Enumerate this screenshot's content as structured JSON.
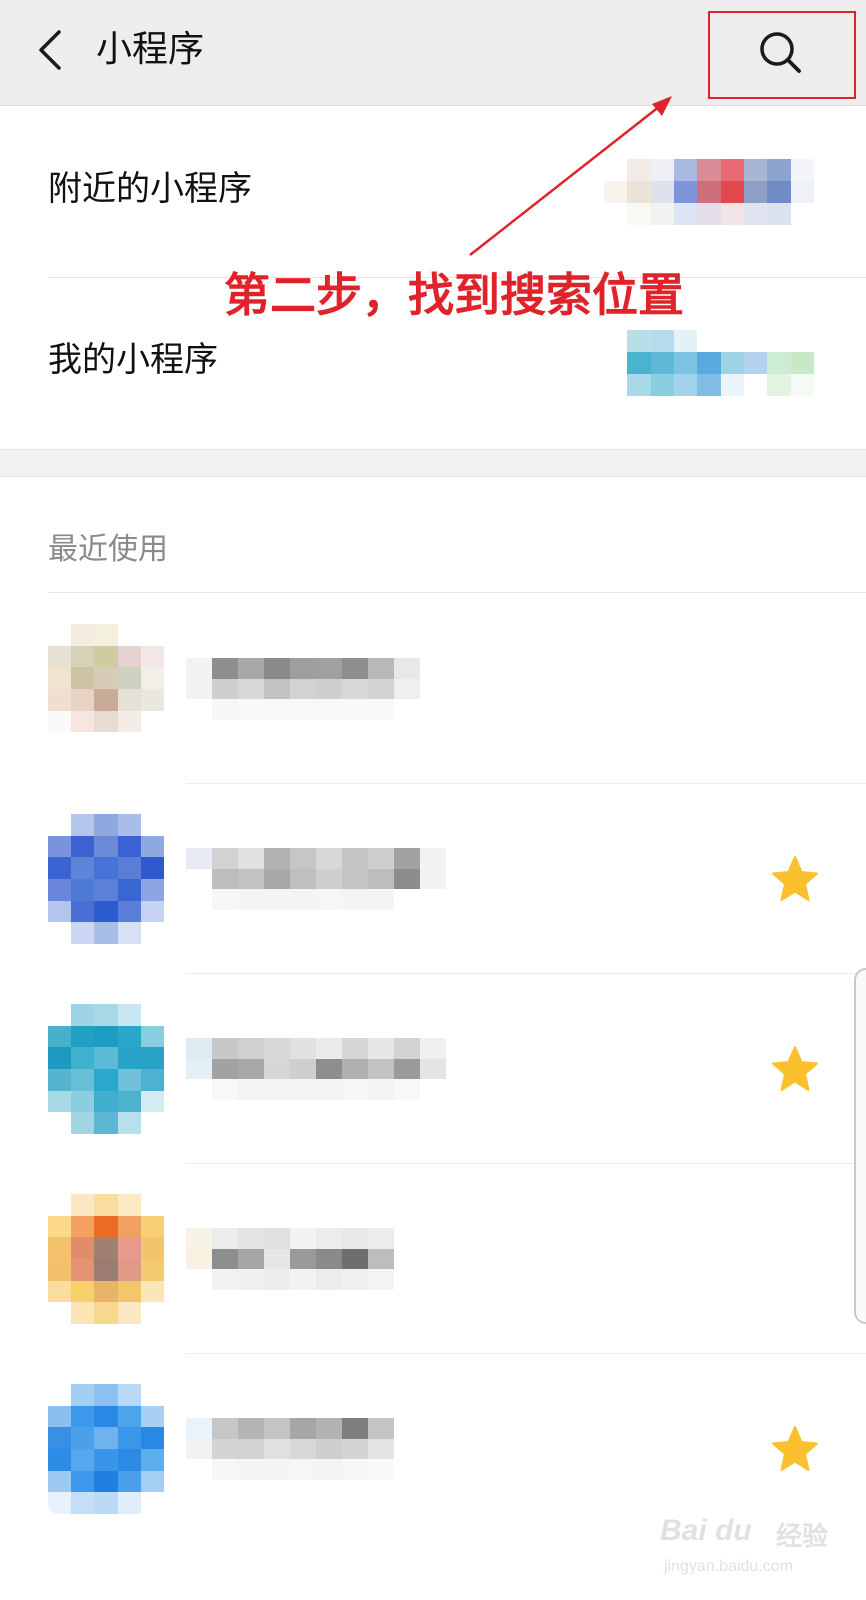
{
  "header": {
    "back_icon": "chevron-left-icon",
    "title": "小程序",
    "search_icon": "search-icon"
  },
  "entries": [
    {
      "label": "附近的小程序",
      "preview_colors": [
        "#ffffff",
        "#f1ede6",
        "#eef0f5",
        "#a9b9e2",
        "#d98c98",
        "#e86a72",
        "#a8b6d4",
        "#8ca5d0",
        "#f4f5f8",
        "#f7f3ea",
        "#ebe4d6",
        "#dfe2ea",
        "#7e96d8",
        "#cf6f7c",
        "#e0474f",
        "#8f9fc4",
        "#6f8cc4",
        "#eef1f6",
        "#ffffff",
        "#faf8f3",
        "#f3f2f2",
        "#dde4f4",
        "#e6ddea",
        "#f2e5e7",
        "#dfe4ef",
        "#dbe3f1",
        "#ffffff"
      ]
    },
    {
      "label": "我的小程序",
      "preview_colors": [
        "#ffffff",
        "#b8dfe8",
        "#b5dcea",
        "#e4f2f8",
        "#ffffff",
        "#ffffff",
        "#ffffff",
        "#ffffff",
        "#ffffff",
        "#ffffff",
        "#4ab3cf",
        "#5fb8d8",
        "#7cc3e2",
        "#5aa9df",
        "#9ed3e5",
        "#b4d2ee",
        "#cdecd4",
        "#c8e8c8",
        "#ffffff",
        "#a8d9e8",
        "#88cde2",
        "#a3d2ec",
        "#7fbde4",
        "#eaf4fa",
        "#ffffff",
        "#e2f3e2",
        "#f4fbf4"
      ]
    }
  ],
  "annotation": {
    "text": "第二步，找到搜索位置",
    "color": "#e0232a"
  },
  "recent": {
    "header": "最近使用",
    "items": [
      {
        "icon_colors": [
          "#ffffff",
          "#f2ede0",
          "#f3f0e0",
          "#ffffff",
          "#ffffff",
          "#e6e1d0",
          "#d6d2b8",
          "#cfcca2",
          "#e6d2d0",
          "#f2e6e6",
          "#f0e4cf",
          "#ccc5a2",
          "#d7ccb6",
          "#cfd2be",
          "#f2eee8",
          "#f2ded0",
          "#e8d2c4",
          "#c8ac98",
          "#e6e0d6",
          "#ece6e0",
          "#fbfaf8",
          "#f7e6e0",
          "#e8dcd2",
          "#f4ece6",
          "#ffffff",
          "#ffffff",
          "#ffffff",
          "#ffffff",
          "#ffffff",
          "#ffffff"
        ],
        "name_colors": [
          "#f2f2f2",
          "#8e8e8e",
          "#a8a8a8",
          "#8a8a8a",
          "#9e9e9e",
          "#a0a0a0",
          "#8e8e8e",
          "#b8b8b8",
          "#e8e8e8",
          "#ffffff",
          "#f2f2f2",
          "#cfcfcf",
          "#d8d8d8",
          "#c2c2c2",
          "#d2d2d2",
          "#cfcfcf",
          "#d8d8d8",
          "#d4d4d4",
          "#f0f0f0",
          "#ffffff",
          "#ffffff",
          "#f6f6f6",
          "#f8f8f8",
          "#f8f8f8",
          "#f8f8f8",
          "#f8f8f8",
          "#f8f8f8",
          "#f8f8f8",
          "#ffffff",
          "#ffffff"
        ],
        "starred": false
      },
      {
        "icon_colors": [
          "#ffffff",
          "#b4c6ec",
          "#8ea8e0",
          "#a8bde8",
          "#ffffff",
          "#7892dc",
          "#3b62d0",
          "#6a8ad8",
          "#3a62d2",
          "#8ea8e0",
          "#3a64d2",
          "#5e86d8",
          "#4674d6",
          "#5a7ed8",
          "#2e58cc",
          "#6a86dc",
          "#4e7ad6",
          "#5a80d8",
          "#3a66d2",
          "#8aa4e4",
          "#b4c4ec",
          "#4a6ed4",
          "#2c5cd0",
          "#5a7ed8",
          "#c6d2f2",
          "#ffffff",
          "#ccd6f2",
          "#a8bcea",
          "#d8e0f4",
          "#ffffff"
        ],
        "name_colors": [
          "#e8ebf6",
          "#d2d2d2",
          "#e2e2e2",
          "#b2b2b2",
          "#c6c6c6",
          "#d8d8d8",
          "#c4c4c4",
          "#cecece",
          "#a2a2a2",
          "#f2f2f2",
          "#ffffff",
          "#bdbdbd",
          "#c2c2c2",
          "#a8a8a8",
          "#bfbfbf",
          "#cfcfcf",
          "#c4c4c4",
          "#bdbdbd",
          "#8c8c8c",
          "#f2f2f2",
          "#ffffff",
          "#f6f6f6",
          "#f4f4f4",
          "#f4f4f4",
          "#f4f4f4",
          "#f6f6f6",
          "#f4f4f4",
          "#f4f4f4",
          "#ffffff",
          "#ffffff"
        ],
        "starred": true
      },
      {
        "icon_colors": [
          "#ffffff",
          "#9dd3e4",
          "#a8d8e8",
          "#c8e6ef",
          "#ffffff",
          "#49b0cc",
          "#21a0c4",
          "#1f9cc2",
          "#2aa6c8",
          "#8acce0",
          "#1e9ac0",
          "#3fb0cf",
          "#5cbad6",
          "#29a4c8",
          "#2aa2c6",
          "#56b4d0",
          "#68c0d8",
          "#2aa8cc",
          "#70c0da",
          "#4cb2d0",
          "#a6d8e6",
          "#8ccddf",
          "#42aecf",
          "#4cb2d0",
          "#d2ecf2",
          "#ffffff",
          "#a0d6e4",
          "#5cb8d2",
          "#b8e0ea",
          "#ffffff"
        ],
        "name_colors": [
          "#dcecf2",
          "#c8c8c8",
          "#d0d0d0",
          "#d8d8d8",
          "#e2e2e2",
          "#ebebeb",
          "#d6d6d6",
          "#e6e6e6",
          "#d2d2d2",
          "#f0f0f0",
          "#e2eff4",
          "#a2a2a2",
          "#a8a8a8",
          "#d6d6d6",
          "#cfcfcf",
          "#8e8e8e",
          "#b0b0b0",
          "#c2c2c2",
          "#9a9a9a",
          "#e4e4e4",
          "#ffffff",
          "#f8f8f8",
          "#f4f4f4",
          "#f4f4f4",
          "#f4f4f4",
          "#f4f4f4",
          "#f6f6f6",
          "#f4f4f4",
          "#f8f8f8",
          "#ffffff"
        ],
        "starred": true
      },
      {
        "icon_colors": [
          "#ffffff",
          "#fbe7c2",
          "#f8dca0",
          "#fbe9c4",
          "#ffffff",
          "#fbd88a",
          "#f4a060",
          "#ec6c24",
          "#f0a060",
          "#f7cf74",
          "#f2c26c",
          "#e28c6c",
          "#a08070",
          "#e8988c",
          "#f2c46c",
          "#f2c06c",
          "#e49474",
          "#9c7c70",
          "#e09a84",
          "#f4ca70",
          "#fadc9c",
          "#f6d06a",
          "#e8b46a",
          "#f4c66c",
          "#fbe6b8",
          "#ffffff",
          "#fbe5b4",
          "#f8d88e",
          "#fbe8c0",
          "#ffffff"
        ],
        "name_colors": [
          "#f6f2e6",
          "#ececec",
          "#e4e4e4",
          "#e0e0e0",
          "#f2f2f2",
          "#ececec",
          "#e8e8e8",
          "#ececec",
          "#ffffff",
          "#ffffff",
          "#f6f1e0",
          "#8e8e8e",
          "#a6a6a6",
          "#e6e6e6",
          "#9a9a9a",
          "#8a8a8a",
          "#6e6e6e",
          "#bdbdbd",
          "#ffffff",
          "#ffffff",
          "#ffffff",
          "#f2f2f2",
          "#f0f0f0",
          "#ececec",
          "#f2f2f2",
          "#ececec",
          "#f0f0f0",
          "#f4f4f4",
          "#ffffff",
          "#ffffff"
        ],
        "starred": false
      },
      {
        "icon_colors": [
          "#ffffff",
          "#a4cdf2",
          "#8cc0ee",
          "#b8d8f4",
          "#ffffff",
          "#8ac0f0",
          "#3c98e8",
          "#2a88e4",
          "#4ca4ea",
          "#a8d0f4",
          "#3890e6",
          "#4aa0ea",
          "#6eb2ee",
          "#3a96e8",
          "#2888e4",
          "#2c8ce6",
          "#56a8ec",
          "#3a94e8",
          "#2a8ae4",
          "#5caeee",
          "#9ccaf2",
          "#3c98e8",
          "#2080e2",
          "#4a9eea",
          "#a4cff4",
          "#e8f2fc",
          "#c4def6",
          "#bcdaf6",
          "#e0eefc",
          "#ffffff"
        ],
        "name_colors": [
          "#eaf2fa",
          "#c6c6c6",
          "#b4b4b4",
          "#c4c4c4",
          "#a6a6a6",
          "#b2b2b2",
          "#7e7e7e",
          "#c4c4c4",
          "#ffffff",
          "#ffffff",
          "#f2f2f2",
          "#d4d4d4",
          "#d2d2d2",
          "#e0e0e0",
          "#d8d8d8",
          "#cfcfcf",
          "#d4d4d4",
          "#e4e4e4",
          "#ffffff",
          "#ffffff",
          "#ffffff",
          "#f6f6f6",
          "#f4f4f4",
          "#f4f4f4",
          "#f6f6f6",
          "#f4f4f4",
          "#f6f6f6",
          "#fafafa",
          "#ffffff",
          "#ffffff"
        ],
        "starred": true
      }
    ]
  },
  "watermark": {
    "logo": "Bai du",
    "cn": "经验",
    "url": "jingyan.baidu.com"
  },
  "colors": {
    "star": "#fbc02d",
    "accent_red": "#e0232a"
  }
}
